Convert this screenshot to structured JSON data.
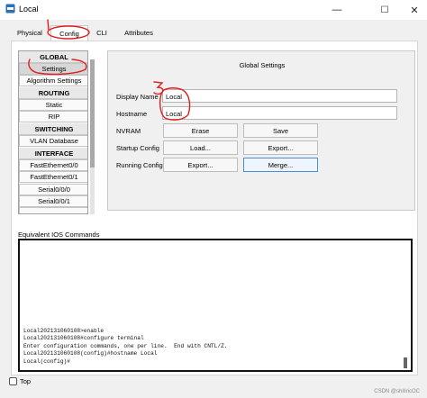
{
  "window": {
    "title": "Local",
    "minimize_glyph": "—",
    "maximize_glyph": "☐",
    "close_glyph": "✕"
  },
  "tabs": [
    {
      "label": "Physical",
      "active": false
    },
    {
      "label": "Config",
      "active": true
    },
    {
      "label": "CLI",
      "active": false
    },
    {
      "label": "Attributes",
      "active": false
    }
  ],
  "nav": {
    "global_header": "GLOBAL",
    "settings": "Settings",
    "algorithm_settings": "Algorithm Settings",
    "routing_header": "ROUTING",
    "static": "Static",
    "rip": "RIP",
    "switching_header": "SWITCHING",
    "vlan_database": "VLAN Database",
    "interface_header": "INTERFACE",
    "fe00": "FastEthernet0/0",
    "fe01": "FastEthernet0/1",
    "s000": "Serial0/0/0",
    "s001": "Serial0/0/1"
  },
  "global_settings": {
    "title": "Global Settings",
    "display_name_label": "Display Name",
    "display_name_value": "Local",
    "hostname_label": "Hostname",
    "hostname_value": "Local",
    "nvram_label": "NVRAM",
    "erase_button": "Erase",
    "save_button": "Save",
    "startup_config_label": "Startup Config",
    "load_button": "Load...",
    "startup_export_button": "Export...",
    "running_config_label": "Running Config",
    "running_export_button": "Export...",
    "merge_button": "Merge..."
  },
  "ios": {
    "label": "Equivalent IOS Commands",
    "lines": "Local202131060108>enable\nLocal202131060108#configure terminal\nEnter configuration commands, one per line.  End with CNTL/Z.\nLocal202131060108(config)#hostname Local\nLocal(config)#"
  },
  "footer": {
    "top_label": "Top",
    "watermark": "CSDN @shitiricOC"
  },
  "annotations": {
    "color": "#e02020",
    "number": "3"
  }
}
